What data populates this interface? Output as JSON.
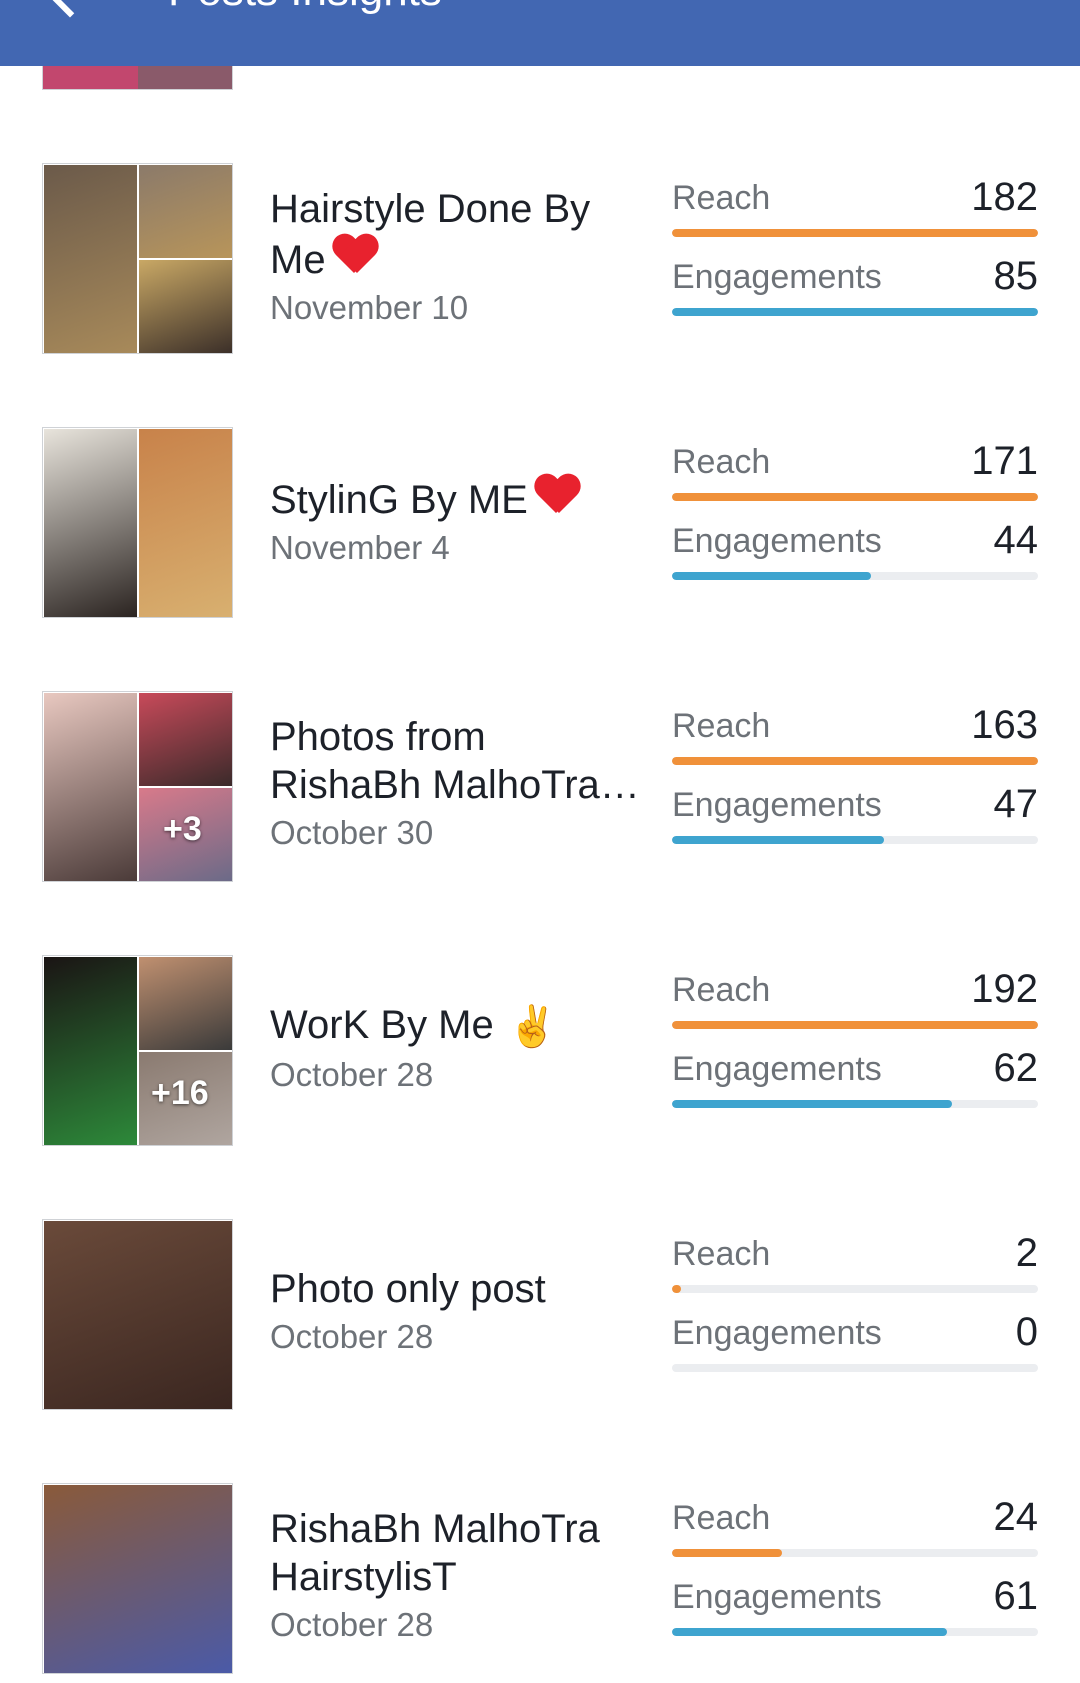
{
  "header": {
    "title": "Posts Insights"
  },
  "colors": {
    "header": "#4267b2",
    "reach_bar": "#f0913a",
    "engagement_bar": "#3ea4cf"
  },
  "posts": [
    {
      "title": "Hairstyle Done By Me",
      "emoji": "heart",
      "date": "November 10",
      "reach_label": "Reach",
      "reach": "182",
      "reach_fraction": 1.0,
      "engagements_label": "Engagements",
      "engagements": "85",
      "engagements_fraction": 1.0,
      "more_count": ""
    },
    {
      "title": "StylinG By ME",
      "emoji": "heart",
      "date": "November 4",
      "reach_label": "Reach",
      "reach": "171",
      "reach_fraction": 1.0,
      "engagements_label": "Engagements",
      "engagements": "44",
      "engagements_fraction": 0.545,
      "more_count": ""
    },
    {
      "title": "Photos from RishaBh MalhoTra…",
      "emoji": "",
      "date": "October 30",
      "reach_label": "Reach",
      "reach": "163",
      "reach_fraction": 1.0,
      "engagements_label": "Engagements",
      "engagements": "47",
      "engagements_fraction": 0.58,
      "more_count": "+3"
    },
    {
      "title": "WorK By Me",
      "emoji": "victory-hand",
      "date": "October 28",
      "reach_label": "Reach",
      "reach": "192",
      "reach_fraction": 1.0,
      "engagements_label": "Engagements",
      "engagements": "62",
      "engagements_fraction": 0.765,
      "more_count": "+16"
    },
    {
      "title": "Photo only post",
      "emoji": "",
      "date": "October 28",
      "reach_label": "Reach",
      "reach": "2",
      "reach_fraction": 0.025,
      "engagements_label": "Engagements",
      "engagements": "0",
      "engagements_fraction": 0.0,
      "more_count": ""
    },
    {
      "title": "RishaBh MalhoTra HairstylisT",
      "emoji": "",
      "date": "October 28",
      "reach_label": "Reach",
      "reach": "24",
      "reach_fraction": 0.3,
      "engagements_label": "Engagements",
      "engagements": "61",
      "engagements_fraction": 0.75,
      "more_count": ""
    }
  ]
}
